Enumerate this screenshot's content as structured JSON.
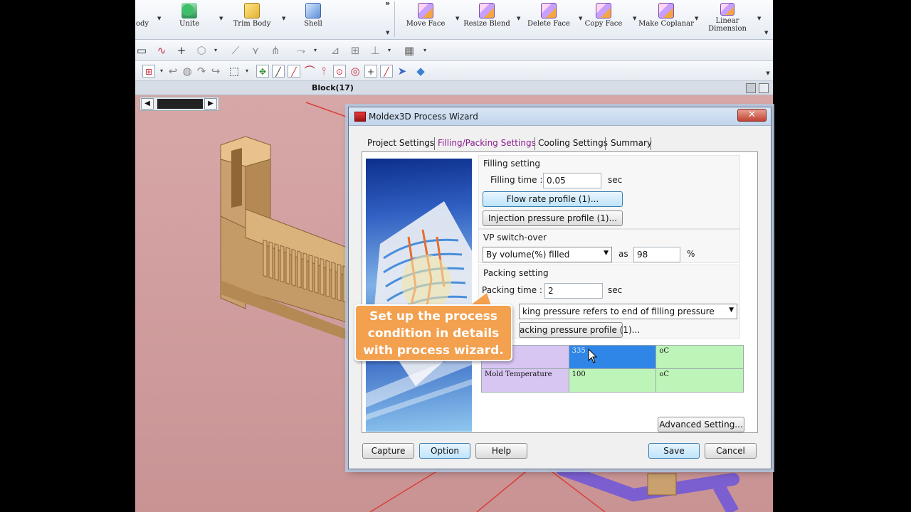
{
  "ribbon": {
    "items": [
      {
        "label": "ody"
      },
      {
        "label": "Unite"
      },
      {
        "label": "Trim Body"
      },
      {
        "label": "Shell"
      },
      {
        "label": "Move Face"
      },
      {
        "label": "Resize Blend"
      },
      {
        "label": "Delete Face"
      },
      {
        "label": "Copy Face"
      },
      {
        "label": "Make Coplanar"
      },
      {
        "label": "Linear Dimension"
      }
    ]
  },
  "blockbar": {
    "label": "Block(17)"
  },
  "dialog": {
    "title": "Moldex3D Process Wizard",
    "close_glyph": "✕",
    "tabs": [
      "Project Settings",
      "Filling/Packing Settings",
      "Cooling Settings",
      "Summary"
    ],
    "active_tab": "Filling/Packing Settings",
    "filling": {
      "header": "Filling setting",
      "time_label": "Filling time :",
      "time_value": "0.05",
      "time_unit": "sec",
      "flow_rate_button": "Flow rate profile (1)...",
      "injection_button": "Injection pressure profile (1)..."
    },
    "vp": {
      "header": "VP switch-over",
      "select_value": "By volume(%) filled",
      "as_label": "as",
      "value": "98",
      "unit": "%"
    },
    "packing": {
      "header": "Packing setting",
      "time_label": "Packing time :",
      "time_value": "2",
      "time_unit": "sec",
      "reference_select": "king pressure refers to end of filling pressure",
      "profile_button": "acking pressure profile (1)..."
    },
    "temperature_table": {
      "rows": [
        {
          "name": "erature",
          "value": "335",
          "unit": "oC"
        },
        {
          "name": "Mold Temperature",
          "value": "100",
          "unit": "oC"
        }
      ]
    },
    "advanced_button": "Advanced Setting...",
    "buttons": {
      "capture": "Capture",
      "option": "Option",
      "help": "Help",
      "save": "Save",
      "cancel": "Cancel"
    }
  },
  "callout": {
    "lines": [
      "Set up the process",
      "condition in details",
      "with process wizard."
    ]
  },
  "colors": {
    "active_tab": "#8b1c8f",
    "callout": "#f3a04f",
    "model": "#c9a06e",
    "viewport": "#cf9d9e"
  }
}
